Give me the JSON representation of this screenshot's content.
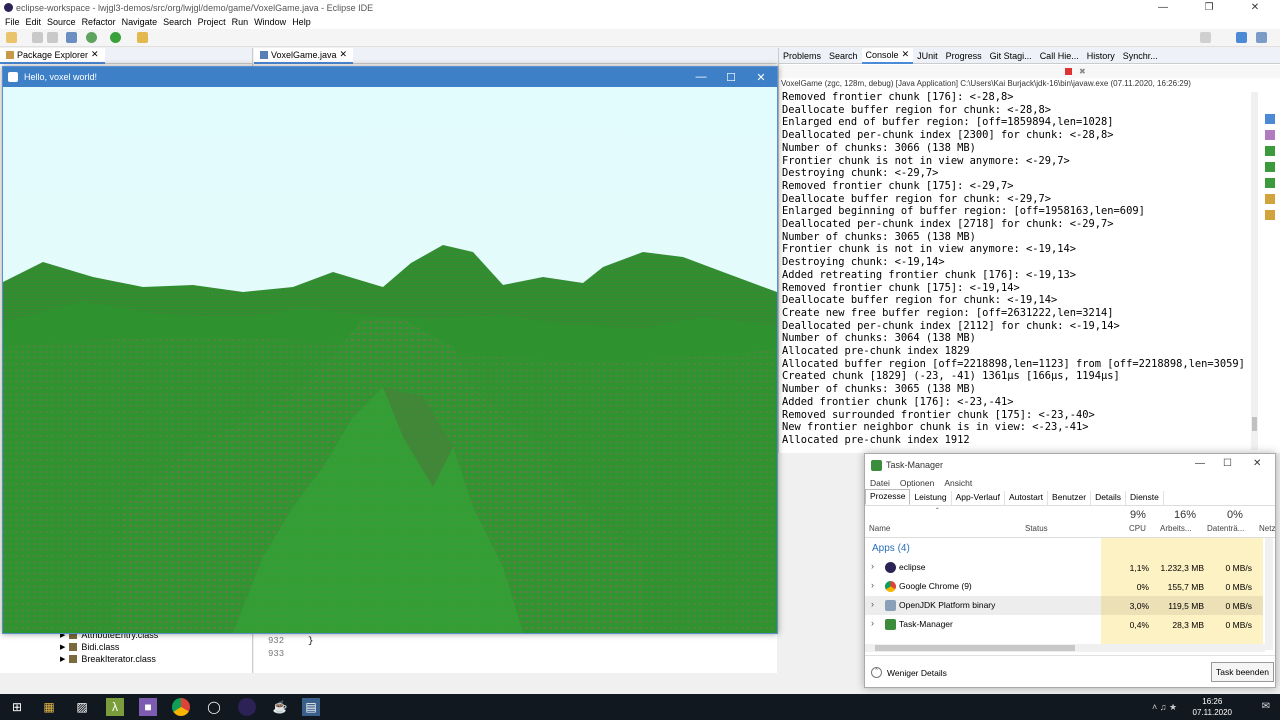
{
  "eclipse": {
    "title": "eclipse-workspace - lwjgl3-demos/src/org/lwjgl/demo/game/VoxelGame.java - Eclipse IDE",
    "menu": [
      "File",
      "Edit",
      "Source",
      "Refactor",
      "Navigate",
      "Search",
      "Project",
      "Run",
      "Window",
      "Help"
    ]
  },
  "package_explorer": {
    "tab_label": "Package Explorer",
    "tree_items": [
      "AttributeEntry.class",
      "Bidi.class",
      "BreakIterator.class"
    ]
  },
  "editor": {
    "tab_label": "VoxelGame.java",
    "line_numbers": [
      "932",
      "933"
    ],
    "code_line": "}"
  },
  "console": {
    "tabs": [
      "Problems",
      "Search",
      "Console",
      "JUnit",
      "Progress",
      "Git Stagi...",
      "Call Hie...",
      "History",
      "Synchr..."
    ],
    "header": "VoxelGame (zgc, 128m, debug) [Java Application] C:\\Users\\Kai Burjack\\jdk-16\\bin\\javaw.exe  (07.11.2020, 16:26:29)",
    "lines": [
      "Removed frontier chunk [176]: <-28,8>",
      "Deallocate buffer region for chunk: <-28,8>",
      "Enlarged end of buffer region: [off=1859894,len=1028]",
      "Deallocated per-chunk index [2300] for chunk: <-28,8>",
      "Number of chunks: 3066 (138 MB)",
      "Frontier chunk is not in view anymore: <-29,7>",
      "Destroying chunk: <-29,7>",
      "Removed frontier chunk [175]: <-29,7>",
      "Deallocate buffer region for chunk: <-29,7>",
      "Enlarged beginning of buffer region: [off=1958163,len=609]",
      "Deallocated per-chunk index [2718] for chunk: <-29,7>",
      "Number of chunks: 3065 (138 MB)",
      "Frontier chunk is not in view anymore: <-19,14>",
      "Destroying chunk: <-19,14>",
      "Added retreating frontier chunk [176]: <-19,13>",
      "Removed frontier chunk [175]: <-19,14>",
      "Deallocate buffer region for chunk: <-19,14>",
      "Create new free buffer region: [off=2631222,len=3214]",
      "Deallocated per-chunk index [2112] for chunk: <-19,14>",
      "Number of chunks: 3064 (138 MB)",
      "Allocated pre-chunk index 1829",
      "Allocated buffer region [off=2218898,len=1123] from [off=2218898,len=3059]",
      "Created chunk [1829] (-23, -41) 1361µs [166µs, 1194µs]",
      "Number of chunks: 3065 (138 MB)",
      "Added frontier chunk [176]: <-23,-41>",
      "Removed surrounded frontier chunk [175]: <-23,-40>",
      "New frontier neighbor chunk is in view: <-23,-41>",
      "Allocated pre-chunk index 1912"
    ]
  },
  "game_window": {
    "title": "Hello, voxel world!"
  },
  "task_manager": {
    "title": "Task-Manager",
    "menu": [
      "Datei",
      "Optionen",
      "Ansicht"
    ],
    "tabs": [
      "Prozesse",
      "Leistung",
      "App-Verlauf",
      "Autostart",
      "Benutzer",
      "Details",
      "Dienste"
    ],
    "columns": {
      "name": "Name",
      "status": "Status",
      "cpu_pct": "9%",
      "cpu": "CPU",
      "mem_pct": "16%",
      "mem": "Arbeits...",
      "disk_pct": "0%",
      "disk": "Datenträ...",
      "net": "Netz"
    },
    "group_label": "Apps (4)",
    "rows": [
      {
        "name": "eclipse",
        "cpu": "1,1%",
        "mem": "1.232,3 MB",
        "disk": "0 MB/s"
      },
      {
        "name": "Google Chrome (9)",
        "cpu": "0%",
        "mem": "155,7 MB",
        "disk": "0 MB/s"
      },
      {
        "name": "OpenJDK Platform binary",
        "cpu": "3,0%",
        "mem": "119,5 MB",
        "disk": "0 MB/s"
      },
      {
        "name": "Task-Manager",
        "cpu": "0,4%",
        "mem": "28,3 MB",
        "disk": "0 MB/s"
      }
    ],
    "fewer_details": "Weniger Details",
    "end_task": "Task beenden"
  },
  "taskbar": {
    "time": "16:26",
    "date": "07.11.2020"
  },
  "colors": {
    "sky": "#e2fbfc",
    "grass": "#2f9530",
    "titlebar_blue": "#3d80c7",
    "cpu_highlight": "#fdf2c4"
  }
}
